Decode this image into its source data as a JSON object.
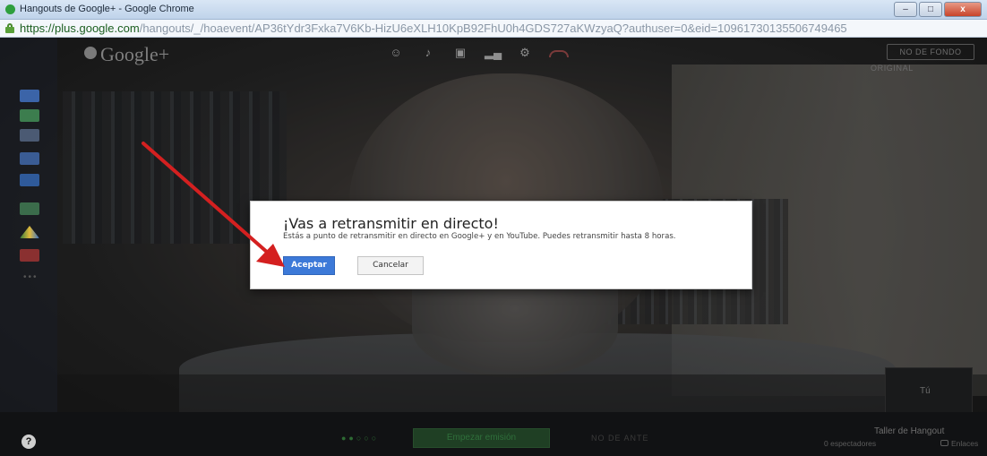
{
  "window": {
    "title": "Hangouts de Google+ - Google Chrome",
    "min_label": "–",
    "max_label": "□",
    "close_label": "x"
  },
  "urlbar": {
    "host": "https://plus.google.com",
    "path": "/hangouts/_/hoaevent/AP36tYdr3Fxka7V6Kb-HizU6eXLH10KpB92FhU0h4GDS727aKWzyaQ?authuser=0&eid=10961730135506749465"
  },
  "hangout": {
    "logo": "Google+",
    "top_right_button": "NO DE FONDO",
    "original_label": "ORIGINAL",
    "self_label": "Tú"
  },
  "dialog": {
    "title": "¡Vas a retransmitir en directo!",
    "text": "Estás a punto de retransmitir en directo en Google+ y en YouTube. Puedes retransmitir hasta 8 horas.",
    "accept_label": "Aceptar",
    "cancel_label": "Cancelar"
  },
  "bottom": {
    "help_label": "?",
    "start_button": "Empezar emisión",
    "live_label": "NO DE ANTE",
    "hangout_name": "Taller de Hangout",
    "viewers": "0 espectadores",
    "links": "Enlaces"
  },
  "icons": {
    "top_controls": [
      "invite-icon",
      "mic-mute-icon",
      "camera-mute-icon",
      "bandwidth-icon",
      "settings-icon",
      "hangup-icon"
    ],
    "rail": [
      "chat-icon",
      "screenshare-icon",
      "captions-icon",
      "youtube-icon",
      "remote-desktop-icon",
      "photo-icon",
      "drive-icon",
      "app-icon"
    ]
  },
  "colors": {
    "accent_blue": "#3c79d8",
    "arrow_red": "#d42020",
    "start_green": "#1f3f24"
  }
}
